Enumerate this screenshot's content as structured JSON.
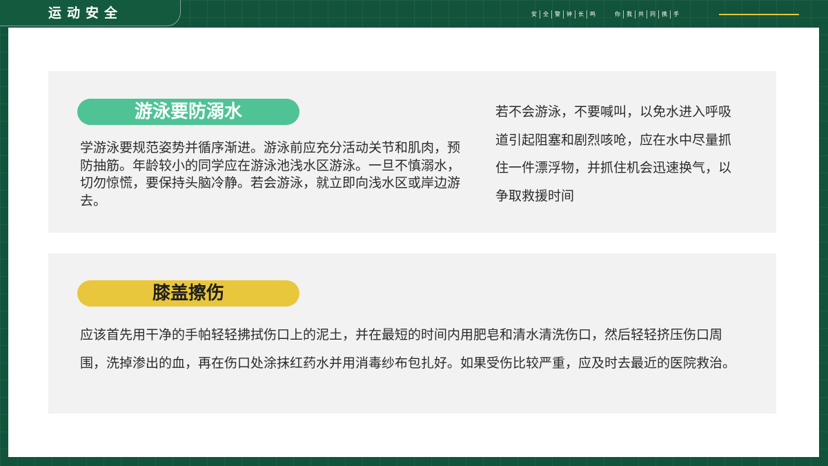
{
  "header": {
    "title": "运动安全",
    "slogan_left": [
      "安",
      "全",
      "警",
      "钟",
      "长",
      "鸣"
    ],
    "slogan_right": [
      "你",
      "我",
      "共",
      "同",
      "携",
      "手"
    ]
  },
  "sections": {
    "swimming": {
      "title": "游泳要防溺水",
      "text_left": "学游泳要规范姿势并循序渐进。游泳前应充分活动关节和肌肉，预防抽筋。年龄较小的同学应在游泳池浅水区游泳。一旦不慎溺水，切勿惊慌，要保持头脑冷静。若会游泳，就立即向浅水区或岸边游去。",
      "text_right": "若不会游泳，不要喊叫，以免水进入呼吸道引起阻塞和剧烈咳呛，应在水中尽量抓住一件漂浮物，并抓住机会迅速换气，以争取救援时间"
    },
    "abrasion": {
      "title": "膝盖擦伤",
      "text": "应该首先用干净的手帕轻轻拂拭伤口上的泥土，并在最短的时间内用肥皂和清水清洗伤口，然后轻轻挤压伤口周围，洗掉渗出的血，再在伤口处涂抹红药水并用消毒纱布包扎好。如果受伤比较严重，应及时去最近的医院救治。"
    }
  },
  "colors": {
    "background": "#12543b",
    "accent_green": "#4fc296",
    "accent_yellow": "#e9c73c",
    "card": "#f2f2f2"
  }
}
